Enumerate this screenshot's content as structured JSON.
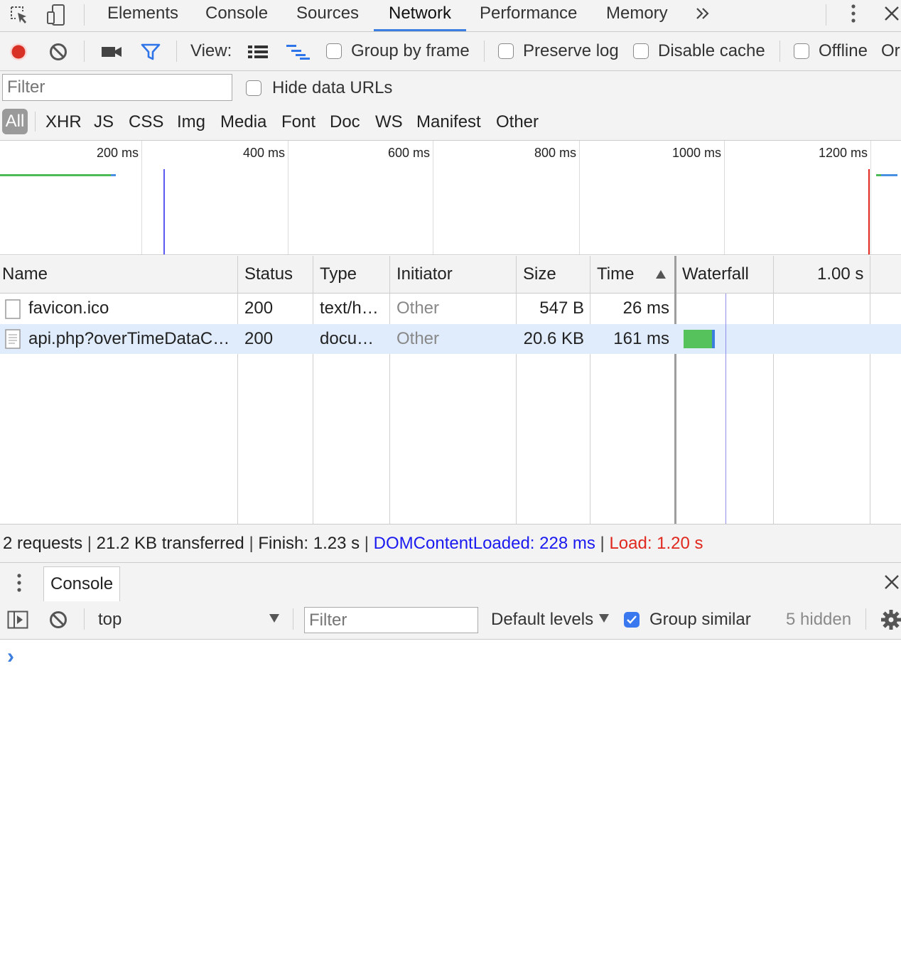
{
  "tabs": [
    "Elements",
    "Console",
    "Sources",
    "Network",
    "Performance",
    "Memory"
  ],
  "active_tab": "Network",
  "toolbar": {
    "view_label": "View:",
    "group_by_frame": "Group by frame",
    "preserve_log": "Preserve log",
    "disable_cache": "Disable cache",
    "offline": "Offline",
    "online_cut": "Or"
  },
  "filter": {
    "placeholder": "Filter",
    "hide_data_urls": "Hide data URLs"
  },
  "types": [
    "All",
    "XHR",
    "JS",
    "CSS",
    "Img",
    "Media",
    "Font",
    "Doc",
    "WS",
    "Manifest",
    "Other"
  ],
  "timeline": {
    "ticks": [
      "200 ms",
      "400 ms",
      "600 ms",
      "800 ms",
      "1000 ms",
      "1200 ms"
    ]
  },
  "table": {
    "headers": {
      "name": "Name",
      "status": "Status",
      "type": "Type",
      "initiator": "Initiator",
      "size": "Size",
      "time": "Time",
      "waterfall": "Waterfall",
      "scale": "1.00 s"
    },
    "rows": [
      {
        "name": "favicon.ico",
        "status": "200",
        "type": "text/h…",
        "initiator": "Other",
        "size": "547 B",
        "time": "26 ms"
      },
      {
        "name": "api.php?overTimeDataC…",
        "status": "200",
        "type": "docu…",
        "initiator": "Other",
        "size": "20.6 KB",
        "time": "161 ms"
      }
    ]
  },
  "summary": {
    "requests": "2 requests",
    "transferred": "21.2 KB transferred",
    "finish": "Finish: 1.23 s",
    "dcl": "DOMContentLoaded: 228 ms",
    "load": "Load: 1.20 s",
    "sep": "|"
  },
  "drawer": {
    "tab": "Console",
    "context": "top",
    "filter_placeholder": "Filter",
    "levels": "Default levels",
    "group_similar": "Group similar",
    "hidden": "5 hidden",
    "prompt": "›"
  },
  "colors": {
    "accent": "#3b7ee0",
    "record": "#d93025",
    "dcl": "#1a1af0",
    "load": "#e0281e",
    "selected_row": "#e0ecfc"
  }
}
